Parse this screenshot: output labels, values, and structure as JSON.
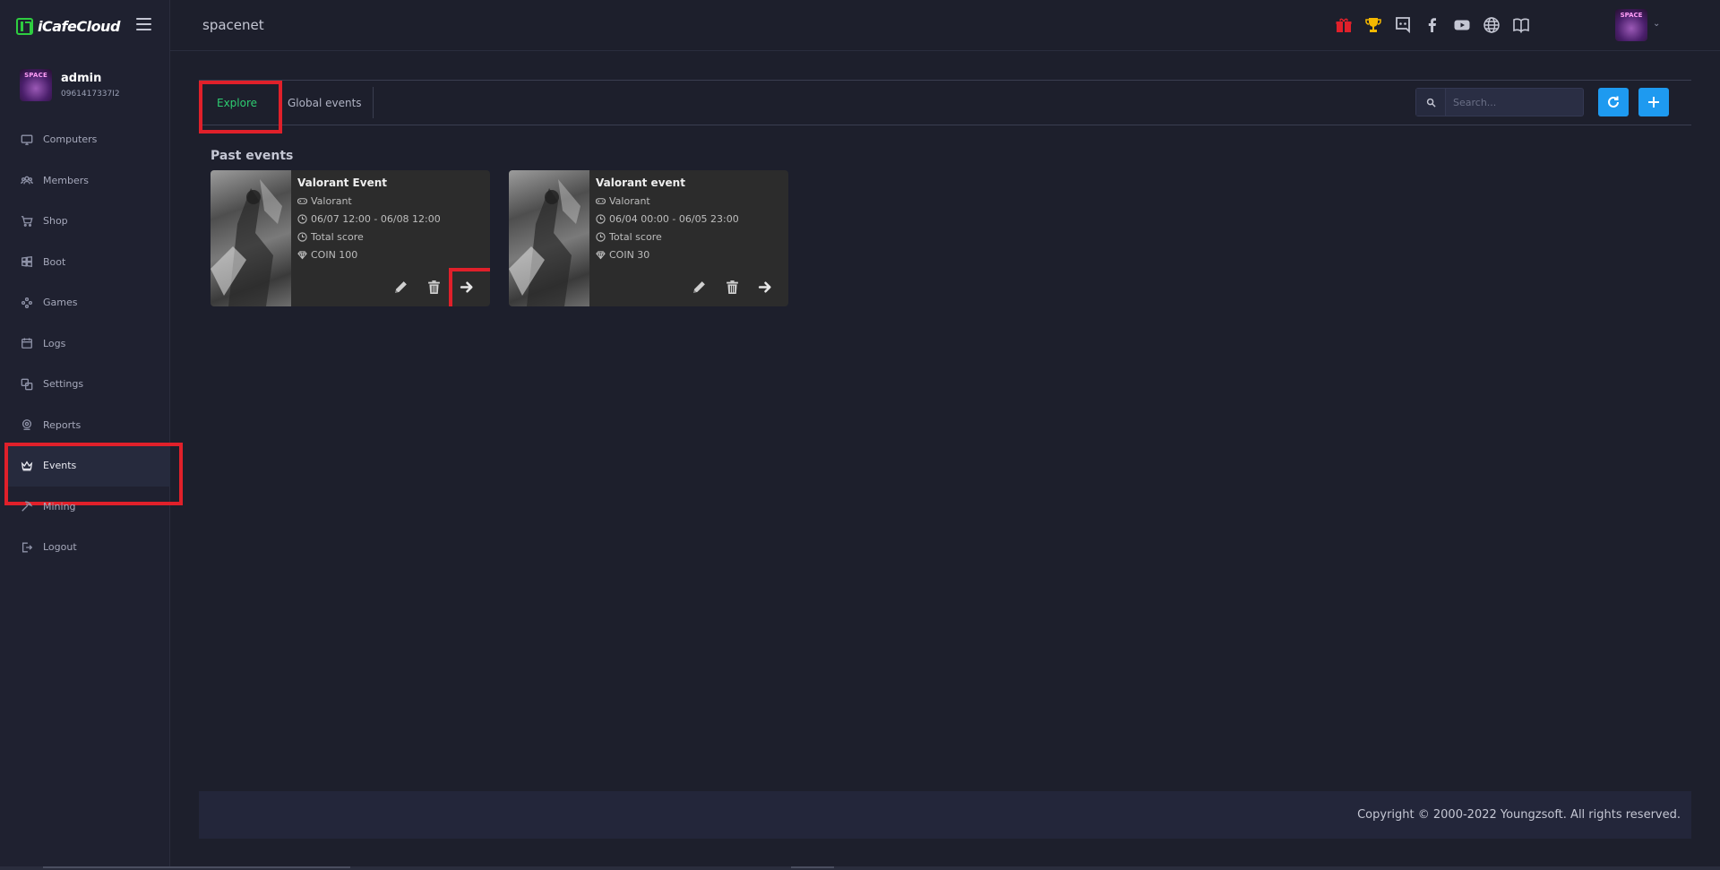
{
  "brand": {
    "name": "iCafeCloud",
    "accent": "#2ecc40"
  },
  "header": {
    "title": "spacenet",
    "icons": [
      "gift-icon",
      "trophy-icon",
      "discord-icon",
      "facebook-icon",
      "youtube-icon",
      "globe-icon",
      "book-icon"
    ],
    "avatar_text": "SPACE"
  },
  "user": {
    "name": "admin",
    "phone": "0961417337I2",
    "avatar_text": "SPACE"
  },
  "sidebar": {
    "items": [
      {
        "label": "Computers",
        "icon": "monitor-icon"
      },
      {
        "label": "Members",
        "icon": "users-icon"
      },
      {
        "label": "Shop",
        "icon": "cart-icon"
      },
      {
        "label": "Boot",
        "icon": "windows-icon"
      },
      {
        "label": "Games",
        "icon": "gamepad-icon"
      },
      {
        "label": "Logs",
        "icon": "calendar-icon"
      },
      {
        "label": "Settings",
        "icon": "settings-icon"
      },
      {
        "label": "Reports",
        "icon": "reports-icon"
      },
      {
        "label": "Events",
        "icon": "crown-icon",
        "active": true
      },
      {
        "label": "Mining",
        "icon": "pickaxe-icon"
      },
      {
        "label": "Logout",
        "icon": "logout-icon"
      }
    ]
  },
  "tabs": {
    "explore": "Explore",
    "global": "Global events"
  },
  "search": {
    "placeholder": "Search..."
  },
  "section": {
    "title": "Past events"
  },
  "events": [
    {
      "title": "Valorant Event",
      "game": "Valorant",
      "time": "06/07 12:00 - 06/08 12:00",
      "score": "Total score",
      "reward": "COIN 100"
    },
    {
      "title": "Valorant event",
      "game": "Valorant",
      "time": "06/04 00:00 - 06/05 23:00",
      "score": "Total score",
      "reward": "COIN 30"
    }
  ],
  "footer": {
    "text": "Copyright © 2000-2022 Youngzsoft. All rights reserved."
  },
  "colors": {
    "primary_blue": "#1e9af0",
    "highlight_red": "#e0202a",
    "tab_active_green": "#2ecc71"
  }
}
